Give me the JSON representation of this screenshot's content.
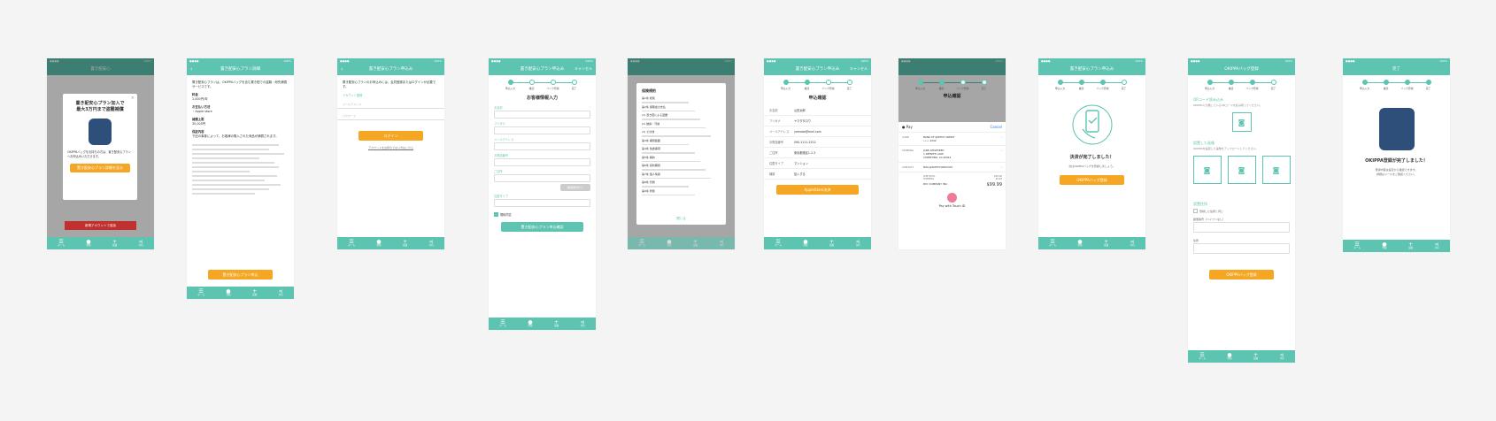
{
  "colors": {
    "teal": "#5cc4b0",
    "orange": "#f5a623",
    "red": "#c0302f"
  },
  "tabbar": [
    {
      "icon": "menu-icon",
      "glyph": "☰",
      "label": "ホーム"
    },
    {
      "icon": "user-icon",
      "glyph": "●",
      "label": "登録"
    },
    {
      "icon": "plus-icon",
      "glyph": "+",
      "label": "追加"
    },
    {
      "icon": "share-icon",
      "glyph": "⋖",
      "label": "共有"
    }
  ],
  "steps": [
    "申込入力",
    "確認",
    "バック登録",
    "完了"
  ],
  "s1": {
    "nav": "置き配安心",
    "modal_title": "置き配安心プラン加入で\n最大3万円まで盗難補償",
    "modal_text": "OKIPPAバッグをお持ちの方は、置き配安心プランへお申込みいただけます。",
    "modal_button": "置き配安心プラン詳細を見る",
    "red_button": "新規アカウントで追加"
  },
  "s2": {
    "nav": "置き配安心プラン詳細",
    "intro": "置き配安心プランは、OKIPPAバッグを含む置き配での盗難・紛失補償サービスです。",
    "price_h": "料金",
    "price": "1,000円/年",
    "pay_h": "お支払い方法",
    "pay": "・Apple store",
    "limit_h": "補償上限",
    "limit": "30,000円",
    "detail_h": "保証内容",
    "detail": "下記の事象によって、お客様の購入された商品が補償されます。",
    "button": "置き配安心プラン申込"
  },
  "s3": {
    "nav": "置き配安心プラン申込み",
    "text": "置き配安心プランのお申込みには、会員登録またはログインが必要です。",
    "login_label": "アカウント登録",
    "email_ph": "メールアドレス",
    "pass_ph": "パスワード",
    "login_button": "ログイン",
    "link": "アカウントをお持ちでない方はこちら"
  },
  "s4": {
    "nav": "置き配安心プラン申込み",
    "nav_r": "キャンセル",
    "title": "お客様情報入力",
    "fields": [
      "お名前",
      "フリガナ",
      "メールアドレス",
      "お電話番号",
      "ご住所",
      "住居タイプ"
    ],
    "zip_button": "郵便番号から",
    "check": "規約同意",
    "button": "置き配安心プラン申込確認"
  },
  "s5": {
    "title": "保険規約",
    "close": "閉じる",
    "lines": [
      "第1条 総則",
      "第2条 保険金の支払",
      "(1) 置き配による盗難",
      "(2) 破損・汚損",
      "(3) その他",
      "第3条 補償範囲",
      "第4条 免責事項",
      "第5条 解約",
      "第6条 契約期間",
      "第7条 個人情報",
      "第8条 管轄",
      "第9条 附則"
    ]
  },
  "s6": {
    "nav": "置き配安心プラン申込み",
    "nav_r": "キャンセル",
    "title": "申込確認",
    "rows": [
      {
        "k": "お名前",
        "v": "山田太郎"
      },
      {
        "k": "フリガナ",
        "v": "ヤマダタロウ"
      },
      {
        "k": "メールアドレス",
        "v": "yamada@mail.com"
      },
      {
        "k": "お電話番号",
        "v": "090-1111-2222"
      },
      {
        "k": "ご住所",
        "v": "東京都港区1-2-3"
      },
      {
        "k": "住居タイプ",
        "v": "マンション"
      },
      {
        "k": "補償",
        "v": "加入する"
      }
    ],
    "button": "AppleStore決済"
  },
  "s7": {
    "title": "申込確認",
    "pay_logo": "Pay",
    "cancel": "Cancel",
    "card_k": "CARD",
    "card_v": "BANK OF SKETCH CREDIT\n•••• 4242",
    "ship_k": "SHIPPING",
    "ship_v": "JANE APPLESEED\n1 INFINITE LOOP\nCUPERTINO, CA 95014",
    "contact_k": "CONTACT",
    "contact_v": "MAIL@SKETCHAPP.COM",
    "sub_k": "SUBTOTAL",
    "sub_v": "$99.00",
    "shipping_k": "SHIPPING",
    "shipping_v": "$0.99",
    "pay_to": "PAY COMPANY INC.",
    "total": "$99.99",
    "touch": "Pay with Touch ID"
  },
  "s8": {
    "nav": "置き配安心プラン申込み",
    "title": "決済が完了しました！",
    "text": "次はOKIPPAバッグを登録しましょう。",
    "button": "OKIPPAバッグ登録"
  },
  "s9": {
    "nav": "OKIPPAバッグ登録",
    "qr_h": "QRコード読み込み",
    "qr_t": "OKIPPAに付属しているQRコードを読み取ってください。",
    "img_h": "設置した画像",
    "img_t": "OKIPPAを設置した画像をアップロードしてください。",
    "addr_h": "設置住所",
    "addr_check": "登録した住所と同じ",
    "zip_ph": "郵便番号（ハイフンなし）",
    "addr_ph": "住所",
    "button": "OKIPPAバッグ登録"
  },
  "s10": {
    "nav": "完了",
    "title": "OKIPPA登録が完了しました！",
    "text": "登録内容は設定から確認できます。\n詳細はメールをご確認ください。"
  }
}
